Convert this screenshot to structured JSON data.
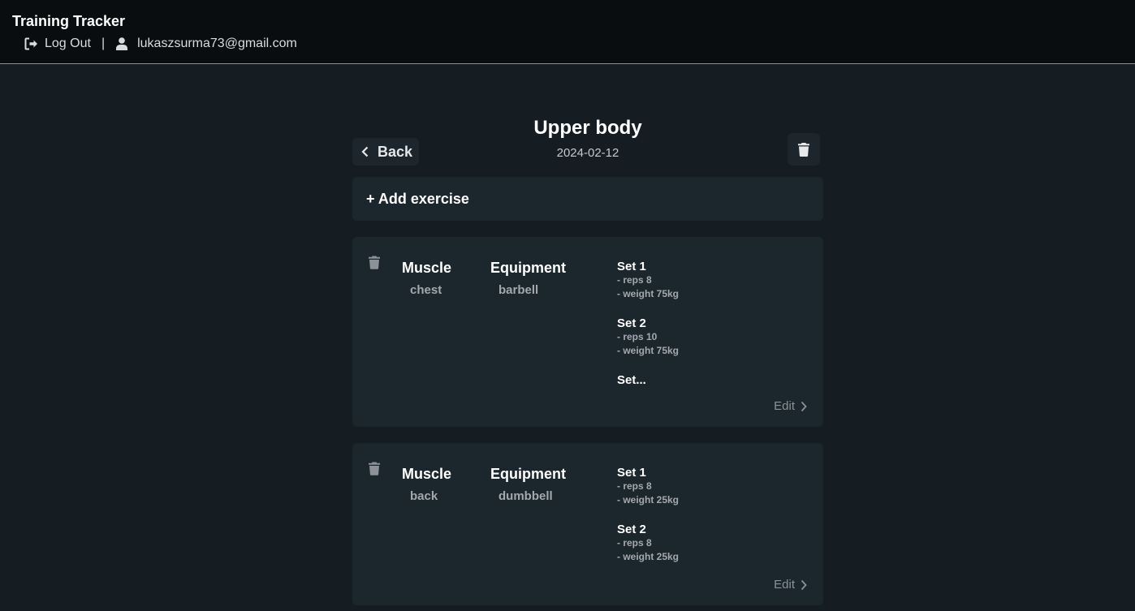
{
  "app": {
    "title": "Training Tracker"
  },
  "nav": {
    "logout_label": "Log Out",
    "separator": "|",
    "user_email": "lukaszsurma73@gmail.com"
  },
  "workout": {
    "back_label": "Back",
    "title": "Upper body",
    "date": "2024-02-12"
  },
  "add_exercise_label": "+ Add exercise",
  "exercises": [
    {
      "muscle_label": "Muscle",
      "muscle": "chest",
      "equipment_label": "Equipment",
      "equipment": "barbell",
      "sets": [
        {
          "title": "Set 1",
          "reps": "- reps 8",
          "weight": "- weight 75kg"
        },
        {
          "title": "Set 2",
          "reps": "- reps 10",
          "weight": "- weight 75kg"
        }
      ],
      "more_sets": "Set...",
      "edit_label": "Edit"
    },
    {
      "muscle_label": "Muscle",
      "muscle": "back",
      "equipment_label": "Equipment",
      "equipment": "dumbbell",
      "sets": [
        {
          "title": "Set 1",
          "reps": "- reps 8",
          "weight": "- weight 25kg"
        },
        {
          "title": "Set 2",
          "reps": "- reps 8",
          "weight": "- weight 25kg"
        }
      ],
      "edit_label": "Edit"
    }
  ],
  "icons": {
    "logout": "logout-icon",
    "user": "user-icon",
    "back": "chevron-left-icon",
    "delete": "trash-icon",
    "edit": "chevron-right-icon"
  },
  "colors": {
    "background": "#151d23",
    "topbar": "#090d10",
    "card": "#1c262d",
    "muted_text": "#a4a9ad"
  }
}
